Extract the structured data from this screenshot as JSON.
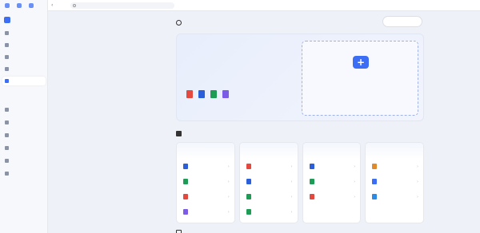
{
  "app": {
    "brand": "",
    "accent": "#3b6ef5"
  },
  "topbar": {
    "search_placeholder": ""
  },
  "sidebar": {
    "nav": [
      {
        "label": "",
        "icon": "home-icon"
      },
      {
        "label": "",
        "icon": "file-search-icon"
      },
      {
        "label": "",
        "icon": "presentation-icon"
      },
      {
        "label": "",
        "icon": "image-icon"
      },
      {
        "label": "",
        "icon": "file-tools-icon"
      }
    ],
    "history_label": "",
    "history": [
      {
        "label": ""
      },
      {
        "label": ""
      },
      {
        "label": ""
      },
      {
        "label": ""
      },
      {
        "label": ""
      },
      {
        "label": ""
      }
    ]
  },
  "main": {
    "title": "",
    "task_button": "",
    "hero": {
      "title": "",
      "lines": [
        "",
        "",
        ""
      ]
    },
    "upload": {
      "title": "",
      "sub_prefix": "",
      "sub_link": ""
    },
    "all_tools": {
      "title": "",
      "subtitle": ""
    },
    "columns": [
      {
        "accent_text": "",
        "title": "",
        "accent_color": "#e5483f",
        "tools": [
          {
            "label": "",
            "icon": "pdf-word-icon",
            "color": "#2b5fd9"
          },
          {
            "label": "",
            "icon": "pdf-excel-icon",
            "color": "#1e9b54"
          },
          {
            "label": "",
            "icon": "pdf-image-icon",
            "color": "#e5483f"
          },
          {
            "label": "",
            "icon": "pdf-long-image-icon",
            "color": "#7c5ce6"
          }
        ]
      },
      {
        "accent_text": "",
        "title": "",
        "accent_color": "#1e9b54",
        "tools": [
          {
            "label": "",
            "icon": "word-pdf-icon",
            "color": "#e5483f"
          },
          {
            "label": "",
            "icon": "word-image-icon",
            "color": "#2b5fd9"
          },
          {
            "label": "",
            "icon": "excel-pdf-icon",
            "color": "#1e9b54"
          },
          {
            "label": "",
            "icon": "excel-image-icon",
            "color": "#1e9b54"
          }
        ]
      },
      {
        "accent_text": "",
        "title": "",
        "accent_color": "#3b6ef5",
        "tools": [
          {
            "label": "",
            "icon": "image-word-icon",
            "color": "#2b5fd9"
          },
          {
            "label": "",
            "icon": "image-excel-icon",
            "color": "#1e9b54"
          },
          {
            "label": "",
            "icon": "image-pdf-icon",
            "color": "#e5483f"
          }
        ]
      },
      {
        "accent_text": "",
        "title": "",
        "accent_color": "#3b6ef5",
        "tools": [
          {
            "label": "",
            "icon": "extract-text-icon",
            "color": "#e08a2c"
          },
          {
            "label": "",
            "icon": "remove-handwriting-icon",
            "color": "#3b6ef5"
          },
          {
            "label": "",
            "icon": "remove-watermark-icon",
            "color": "#2b8be6"
          }
        ]
      }
    ],
    "scan": {
      "title": "",
      "export_label": ""
    }
  }
}
